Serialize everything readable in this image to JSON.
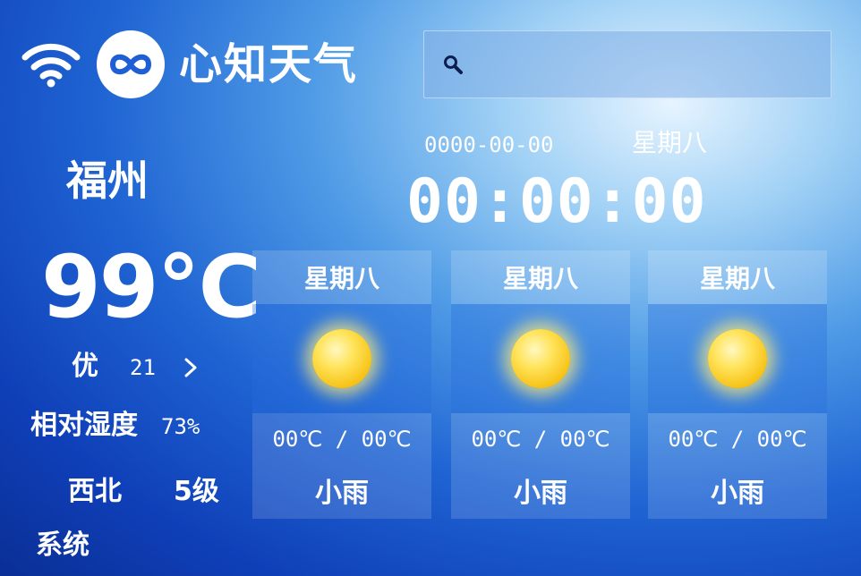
{
  "header": {
    "brand": "心知天气",
    "search_placeholder": ""
  },
  "datetime": {
    "date": "0000-00-00",
    "weekday": "星期八",
    "time": "00:00:00"
  },
  "current": {
    "city": "福州",
    "temperature": "99°C",
    "air_quality_label": "优",
    "air_quality_value": "21",
    "humidity_label": "相对湿度",
    "humidity_value": "73%",
    "wind_direction": "西北",
    "wind_level": "5级",
    "system_label": "系统"
  },
  "forecast": [
    {
      "weekday": "星期八",
      "range": "00℃ / 00℃",
      "condition": "小雨",
      "icon": "sun-icon"
    },
    {
      "weekday": "星期八",
      "range": "00℃ / 00℃",
      "condition": "小雨",
      "icon": "sun-icon"
    },
    {
      "weekday": "星期八",
      "range": "00℃ / 00℃",
      "condition": "小雨",
      "icon": "sun-icon"
    }
  ],
  "icons": {
    "wifi": "wifi-icon",
    "logo": "infinity-logo-icon",
    "search": "search-icon",
    "arrow": "chevron-right-icon"
  },
  "colors": {
    "background_dark": "#0a2f95",
    "background_mid": "#1f64d3",
    "background_light": "#9fd0f5",
    "logo_blue": "#1f5fd6",
    "sun": "#f7c51c",
    "text": "#ffffff"
  }
}
